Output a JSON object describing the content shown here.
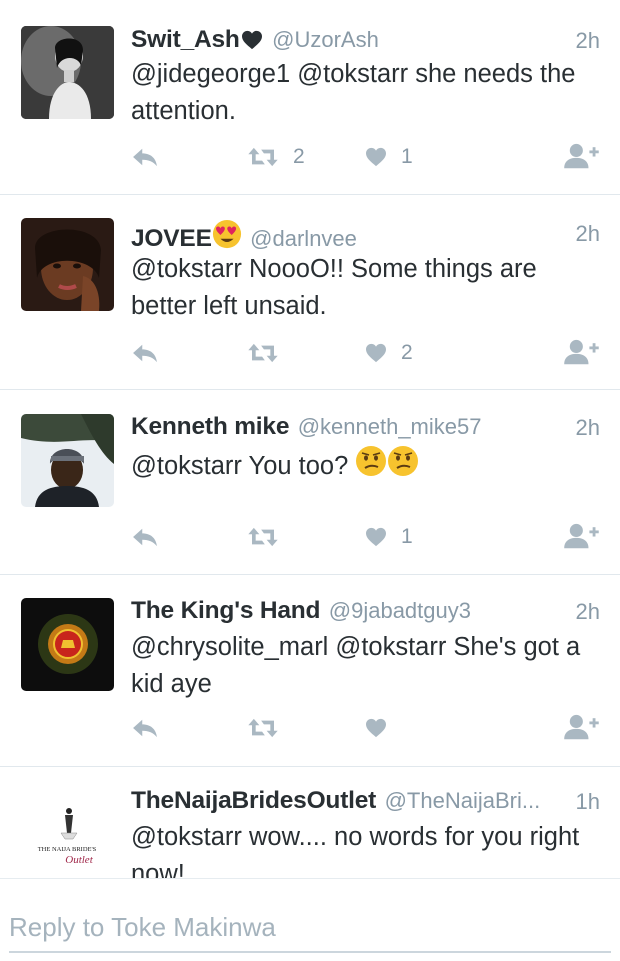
{
  "tweets": [
    {
      "name": "Swit_Ash",
      "handle": "@UzorAsh",
      "time": "2h",
      "text": "@jidegeorge1 @tokstarr she needs the attention.",
      "retweets": "2",
      "likes": "1"
    },
    {
      "name": "JOVEE",
      "handle": "@darlnvee",
      "time": "2h",
      "text": "@tokstarr NoooO!! Some things are better left unsaid.",
      "retweets": "",
      "likes": "2"
    },
    {
      "name": "Kenneth mike",
      "handle": "@kenneth_mike57",
      "time": "2h",
      "text": "@tokstarr You too?",
      "retweets": "",
      "likes": "1"
    },
    {
      "name": "The King's Hand",
      "handle": "@9jabadtguy3",
      "time": "2h",
      "text": "@chrysolite_marl @tokstarr She's got a kid aye",
      "retweets": "",
      "likes": ""
    },
    {
      "name": "TheNaijaBridesOutlet",
      "handle": "@TheNaijaBri...",
      "time": "1h",
      "text": "@tokstarr wow.... no words for you right now!",
      "avatar_logo_line1": "THE NAIJA BRIDE'S",
      "avatar_logo_line2": "Outlet"
    }
  ],
  "reply": {
    "placeholder": "Reply to Toke Makinwa"
  },
  "colors": {
    "icon": "#aab8c2",
    "meta": "#8899a6",
    "text": "#292f33",
    "divider": "#e1e8ed"
  },
  "icons": [
    "reply-icon",
    "retweet-icon",
    "heart-icon",
    "follow-icon",
    "black-heart-emoji",
    "heart-eyes-emoji",
    "confused-face-emoji"
  ]
}
